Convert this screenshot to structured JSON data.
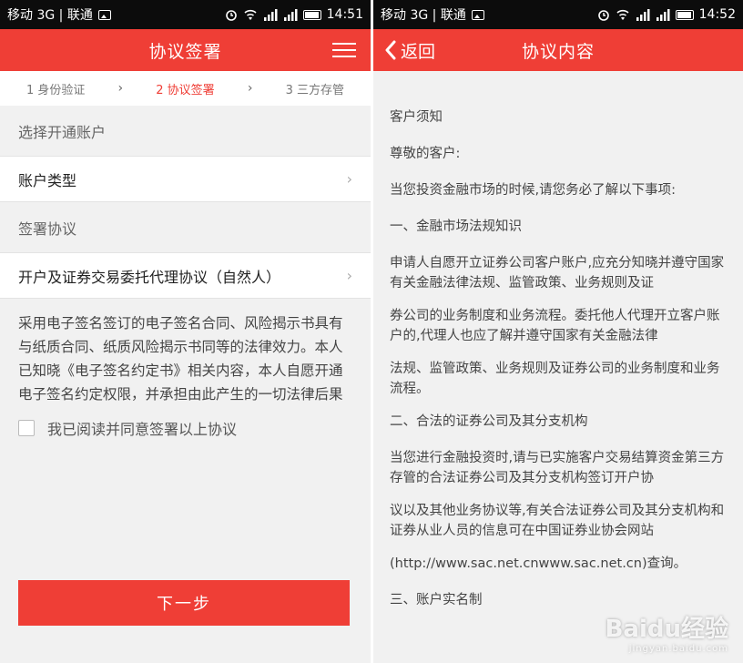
{
  "left": {
    "status": {
      "carrier": "移动 3G | 联通",
      "time": "14:51"
    },
    "header": {
      "title": "协议签署"
    },
    "steps": [
      {
        "label": "1 身份验证"
      },
      {
        "label": "2 协议签署"
      },
      {
        "label": "3 三方存管"
      }
    ],
    "section_account": "选择开通账户",
    "account_type": "账户类型",
    "section_agreement": "签署协议",
    "agreement_item": "开户及证券交易委托代理协议（自然人）",
    "notice": "采用电子签名签订的电子签名合同、风险揭示书具有与纸质合同、纸质风险揭示书同等的法律效力。本人已知晓《电子签名约定书》相关内容，本人自愿开通电子签名约定权限，并承担由此产生的一切法律后果",
    "agree_label": "我已阅读并同意签署以上协议",
    "next_label": "下一步"
  },
  "right": {
    "status": {
      "carrier": "移动 3G | 联通",
      "time": "14:52"
    },
    "header": {
      "back_label": "返回",
      "title": "协议内容"
    },
    "paragraphs": [
      "客户须知",
      "尊敬的客户:",
      "当您投资金融市场的时候,请您务必了解以下事项:",
      "一、金融市场法规知识",
      "申请人自愿开立证券公司客户账户,应充分知晓并遵守国家有关金融法律法规、监管政策、业务规则及证",
      "券公司的业务制度和业务流程。委托他人代理开立客户账户的,代理人也应了解并遵守国家有关金融法律",
      "法规、监管政策、业务规则及证券公司的业务制度和业务流程。",
      "二、合法的证券公司及其分支机构",
      "当您进行金融投资时,请与已实施客户交易结算资金第三方存管的合法证券公司及其分支机构签订开户协",
      "议以及其他业务协议等,有关合法证券公司及其分支机构和证券从业人员的信息可在中国证券业协会网站",
      "(http://www.sac.net.cnwww.sac.net.cn)查询。",
      "三、账户实名制"
    ]
  },
  "watermark": {
    "brand": "Baidu经验",
    "url": "jingyan.baidu.com"
  },
  "colors": {
    "accent": "#ef3e36",
    "statusbar": "#0c0c0c",
    "background": "#f1f1f1"
  },
  "icons": [
    "image-icon",
    "alarm-icon",
    "wifi-icon",
    "signal-icon",
    "battery-icon",
    "menu-icon",
    "chevron-right-icon",
    "back-arrow-icon"
  ]
}
